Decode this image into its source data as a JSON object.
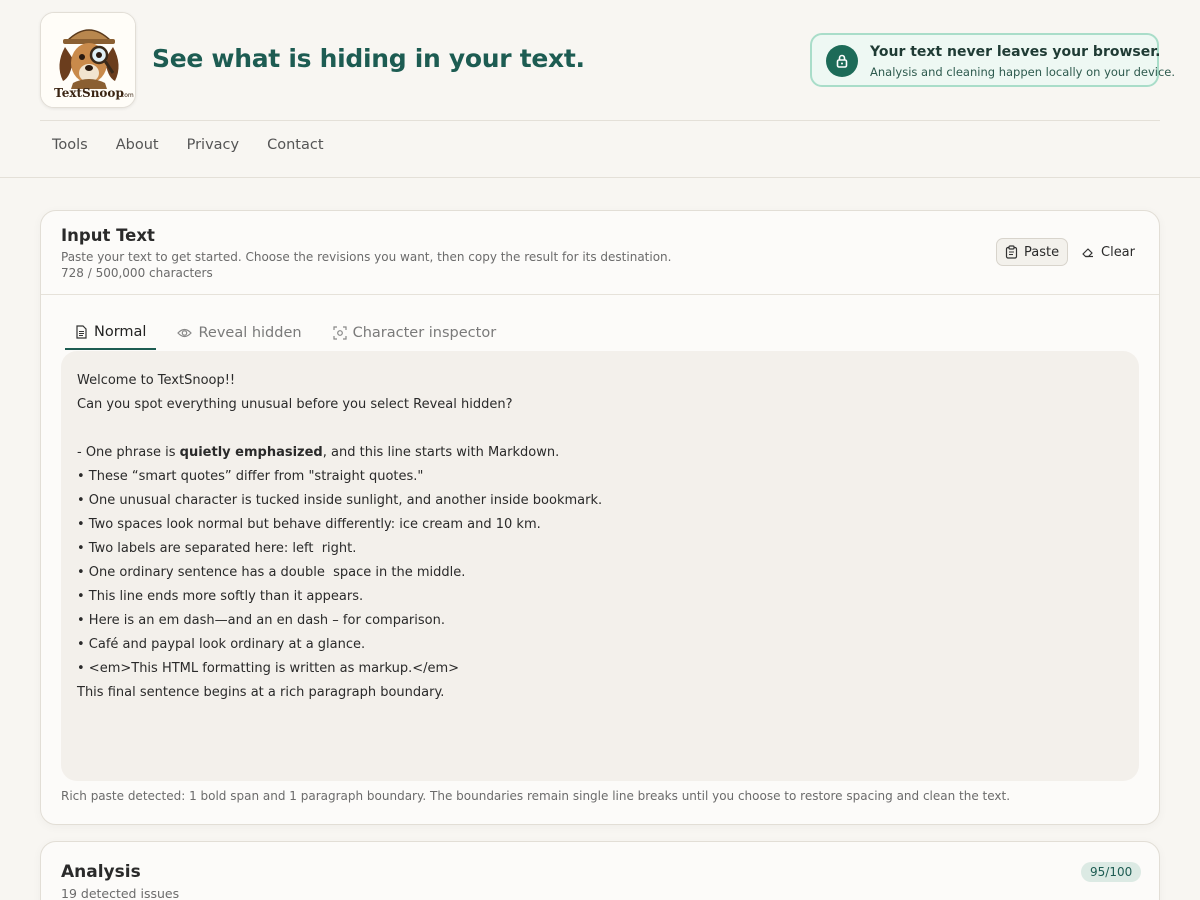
{
  "header": {
    "logo_alt": "TextSnoop.com",
    "tagline": "See what is hiding in your text.",
    "privacy": {
      "title": "Your text never leaves your browser.",
      "subtitle": "Analysis and cleaning happen locally on your device."
    }
  },
  "nav": {
    "items": [
      "Tools",
      "About",
      "Privacy",
      "Contact"
    ]
  },
  "input_card": {
    "title": "Input Text",
    "subtitle": "Paste your text to get started. Choose the revisions you want, then copy the result for its destination.",
    "count": "728 / 500,000 characters",
    "paste_label": "Paste",
    "clear_label": "Clear",
    "tabs": [
      "Normal",
      "Reveal hidden",
      "Character inspector"
    ],
    "active_tab": "Normal",
    "editor_lines": [
      "Welcome to TextSnoop!!",
      "Can you spot everything unusual before you select Reveal hidden?",
      "",
      "- One phrase is ",
      "• These “smart quotes” differ from \"straight quotes.\"",
      "• One unusual character is tucked inside sunlight, and another inside bookmark.",
      "• Two spaces look normal but behave differently: ice cream and 10 km.",
      "• Two labels are separated here: left  right.",
      "• One ordinary sentence has a double  space in the middle.",
      "• This line ends more softly than it appears.",
      "• Here is an em dash—and an en dash – for comparison.",
      "• Café and paypal look ordinary at a glance.",
      "• <em>This HTML formatting is written as markup.</em>",
      "This final sentence begins at a rich paragraph boundary."
    ],
    "line4_bold": "quietly emphasized",
    "line4_tail": ", and this line starts with Markdown.",
    "footnote": "Rich paste detected: 1 bold span and 1 paragraph boundary. The boundaries remain single line breaks until you choose to restore spacing and clean the text."
  },
  "analysis_card": {
    "title": "Analysis",
    "issues": "19 detected issues",
    "score": "95/100"
  },
  "colors": {
    "brand": "#1d5c52",
    "badge_bg": "#eef8f3",
    "badge_border": "#a9ddc9"
  }
}
